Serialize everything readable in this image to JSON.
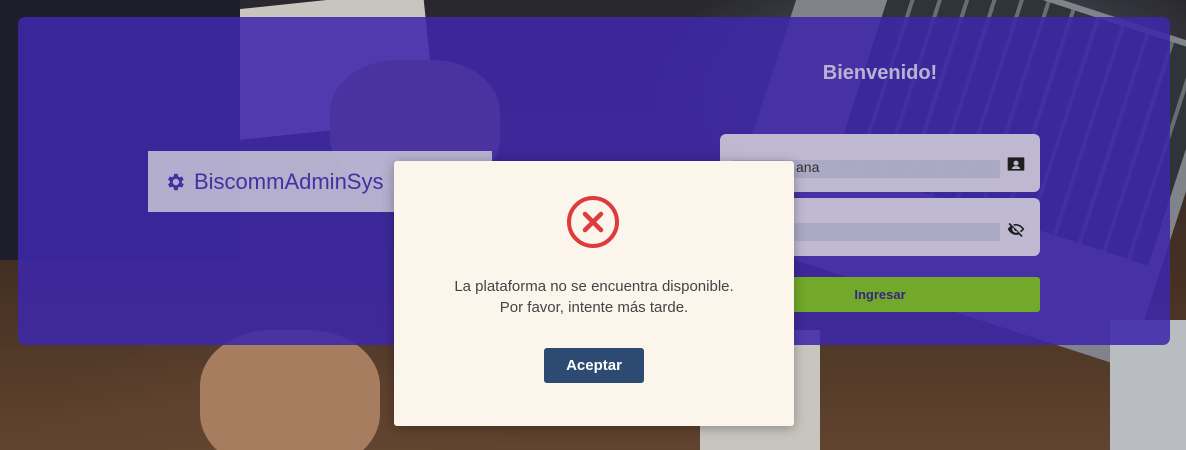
{
  "brand": {
    "name": "BiscommAdminSys",
    "icon": "gear-icon"
  },
  "login": {
    "title": "Bienvenido!",
    "username_value": "ana",
    "username_icon": "user-card-icon",
    "password_value": "",
    "password_icon": "eye-off-icon",
    "submit_label": "Ingresar"
  },
  "dialog": {
    "icon": "error-x-icon",
    "message_line1": "La plataforma no se encuentra disponible.",
    "message_line2": "Por favor, intente más tarde.",
    "confirm_label": "Aceptar"
  },
  "colors": {
    "panel": "#432bb8",
    "submit": "#7cb82e",
    "confirm": "#2c4a72",
    "error": "#dc3c3c"
  }
}
